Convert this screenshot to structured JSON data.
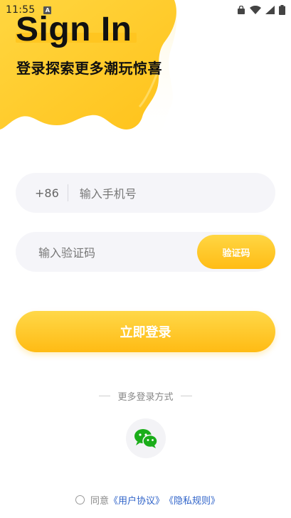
{
  "status_bar": {
    "time": "11:55",
    "a_badge": "A",
    "icons": [
      "lock-icon",
      "wifi-icon",
      "signal-icon",
      "battery-icon"
    ]
  },
  "header": {
    "title": "Sign In",
    "subtitle": "登录探索更多潮玩惊喜"
  },
  "phone": {
    "prefix": "+86",
    "placeholder": "输入手机号"
  },
  "code": {
    "placeholder": "输入验证码",
    "button_label": "验证码"
  },
  "login": {
    "button_label": "立即登录"
  },
  "more_methods": {
    "label": "更多登录方式",
    "wechat_icon": "wechat-icon"
  },
  "agreement": {
    "prefix": "同意",
    "user_agreement": "《用户协议》",
    "privacy_policy": "《隐私规则》"
  },
  "colors": {
    "accent_yellow": "#ffc41f",
    "input_bg": "#f5f5f9",
    "link_blue": "#2f63c9",
    "wechat_green": "#1aad19"
  }
}
